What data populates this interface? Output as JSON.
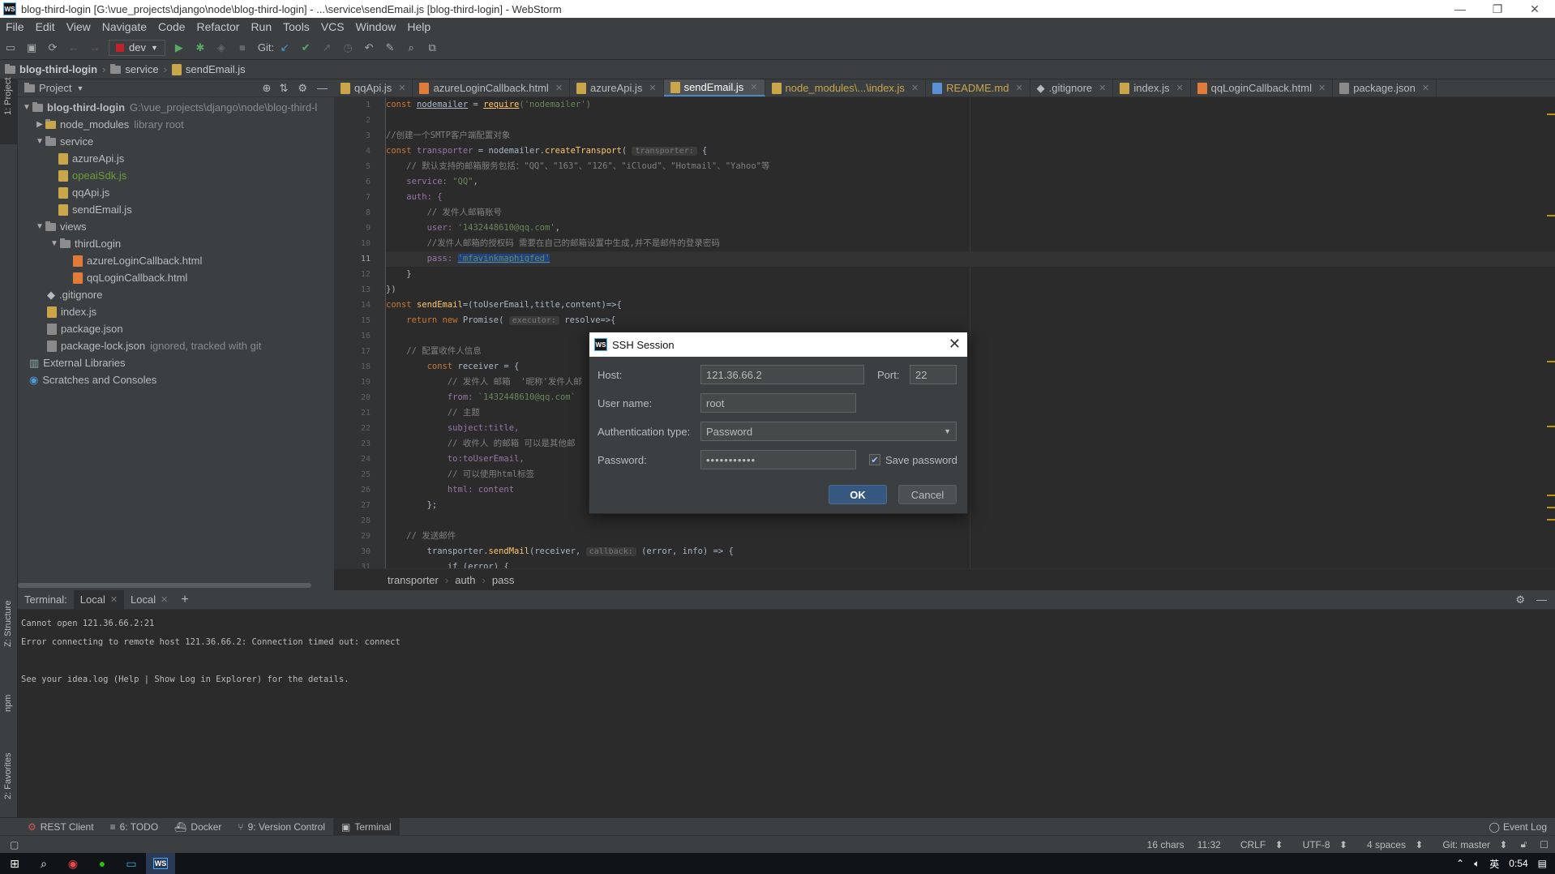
{
  "window": {
    "title": "blog-third-login [G:\\vue_projects\\django\\node\\blog-third-login] - ...\\service\\sendEmail.js [blog-third-login] - WebStorm",
    "app_badge": "WS"
  },
  "menu": [
    "File",
    "Edit",
    "View",
    "Navigate",
    "Code",
    "Refactor",
    "Run",
    "Tools",
    "VCS",
    "Window",
    "Help"
  ],
  "toolbar": {
    "run_config": "dev",
    "git_label": "Git:"
  },
  "navbar": {
    "project": "blog-third-login",
    "folder": "service",
    "file": "sendEmail.js"
  },
  "project_panel": {
    "title": "Project",
    "root_name": "blog-third-login",
    "root_path": "G:\\vue_projects\\django\\node\\blog-third-l",
    "items": [
      {
        "label": "node_modules",
        "note": "library root"
      },
      {
        "label": "service"
      },
      {
        "label": "azureApi.js"
      },
      {
        "label": "opeaiSdk.js"
      },
      {
        "label": "qqApi.js"
      },
      {
        "label": "sendEmail.js"
      },
      {
        "label": "views"
      },
      {
        "label": "thirdLogin"
      },
      {
        "label": "azureLoginCallback.html"
      },
      {
        "label": "qqLoginCallback.html"
      },
      {
        "label": ".gitignore"
      },
      {
        "label": "index.js"
      },
      {
        "label": "package.json"
      },
      {
        "label": "package-lock.json",
        "note": "ignored, tracked with git"
      },
      {
        "label": "External Libraries"
      },
      {
        "label": "Scratches and Consoles"
      }
    ]
  },
  "tabs": [
    "qqApi.js",
    "azureLoginCallback.html",
    "azureApi.js",
    "sendEmail.js",
    "node_modules\\...\\index.js",
    "README.md",
    ".gitignore",
    "index.js",
    "qqLoginCallback.html",
    "package.json"
  ],
  "code": {
    "line_numbers": [
      "1",
      "2",
      "3",
      "4",
      "5",
      "6",
      "7",
      "8",
      "9",
      "10",
      "11",
      "12",
      "13",
      "14",
      "15",
      "16",
      "17",
      "18",
      "19",
      "20",
      "21",
      "22",
      "23",
      "24",
      "25",
      "26",
      "27",
      "28",
      "29",
      "30",
      "31"
    ],
    "l1a": "const ",
    "l1b": "nodemailer",
    "l1c": " = ",
    "l1d": "require",
    "l1e": "('nodemailer')",
    "l3": "//创建一个SMTP客户端配置对象",
    "l4a": "const ",
    "l4b": "transporter",
    "l4c": " = nodemailer.",
    "l4d": "createTransport",
    "l4e": "( ",
    "l4hint": "transporter:",
    "l4f": " {",
    "l5": "    // 默认支持的邮箱服务包括：\"QQ\"、\"163\"、\"126\"、\"iCloud\"、\"Hotmail\"、\"Yahoo\"等",
    "l6a": "    service: ",
    "l6b": "\"QQ\"",
    "l6c": ",",
    "l7": "    auth: {",
    "l8": "        // 发件人邮箱账号",
    "l9a": "        user: ",
    "l9b": "'1432448610@qq.com'",
    "l9c": ",",
    "l10": "        //发件人邮箱的授权码 需要在自己的邮箱设置中生成,并不是邮件的登录密码",
    "l11a": "        pass: ",
    "l11b": "'mfavinkmaphigfed'",
    "l12": "    }",
    "l13": "})",
    "l14a": "const ",
    "l14b": "sendEmail",
    "l14c": "=(toUserEmail,title,content)=>{",
    "l15a": "    return new ",
    "l15b": "Promise",
    "l15c": "( ",
    "l15hint": "executor:",
    "l15d": " resolve=>{",
    "l17": "    // 配置收件人信息",
    "l18a": "        const ",
    "l18b": "receiver",
    "l18c": " = {",
    "l19": "            // 发件人 邮箱  '昵称'发件人邮",
    "l20a": "            from: ",
    "l20b": "`1432448610@qq.com`",
    "l21": "            // 主题",
    "l22": "            subject:title,",
    "l23": "            // 收件人 的邮箱 可以是其他邮",
    "l24": "            to:toUserEmail,",
    "l25": "            // 可以使用html标签",
    "l26": "            html: content",
    "l27": "        };",
    "l29": "    // 发送邮件",
    "l30a": "        transporter.",
    "l30b": "sendMail",
    "l30c": "(receiver, ",
    "l30hint": "callback:",
    "l30d": " (error, info) => {",
    "l31": "            if (error) {"
  },
  "breadcrumb": [
    "transporter",
    "auth",
    "pass"
  ],
  "terminal": {
    "label": "Terminal:",
    "tabs": [
      "Local",
      "Local"
    ],
    "lines": [
      "Cannot open 121.36.66.2:21",
      "Error connecting to remote host 121.36.66.2: Connection timed out: connect",
      "",
      "See your idea.log (Help | Show Log in Explorer) for the details."
    ]
  },
  "left_strip": {
    "project": "1: Project",
    "structure": "Z: Structure",
    "npm": "npm",
    "favorites": "2: Favorites"
  },
  "bottom_tools": [
    "REST Client",
    "6: TODO",
    "Docker",
    "9: Version Control",
    "Terminal"
  ],
  "event_log": "Event Log",
  "status": {
    "chars": "16 chars",
    "position": "11:32",
    "line_sep": "CRLF",
    "encoding": "UTF-8",
    "indent": "4 spaces",
    "git": "Git: master"
  },
  "taskbar": {
    "clock": "0:54",
    "ime": "英"
  },
  "dialog": {
    "title": "SSH Session",
    "host_label": "Host:",
    "host": "121.36.66.2",
    "port_label": "Port:",
    "port": "22",
    "user_label": "User name:",
    "user": "root",
    "auth_label": "Authentication type:",
    "auth": "Password",
    "password_label": "Password:",
    "password": "•••••••••••",
    "save_password": "Save password",
    "save_checked": true,
    "ok": "OK",
    "cancel": "Cancel"
  },
  "colors": {
    "accent": "#4a88c7",
    "ok_button": "#365880",
    "background": "#2b2b2b",
    "panel": "#3c3f41"
  }
}
